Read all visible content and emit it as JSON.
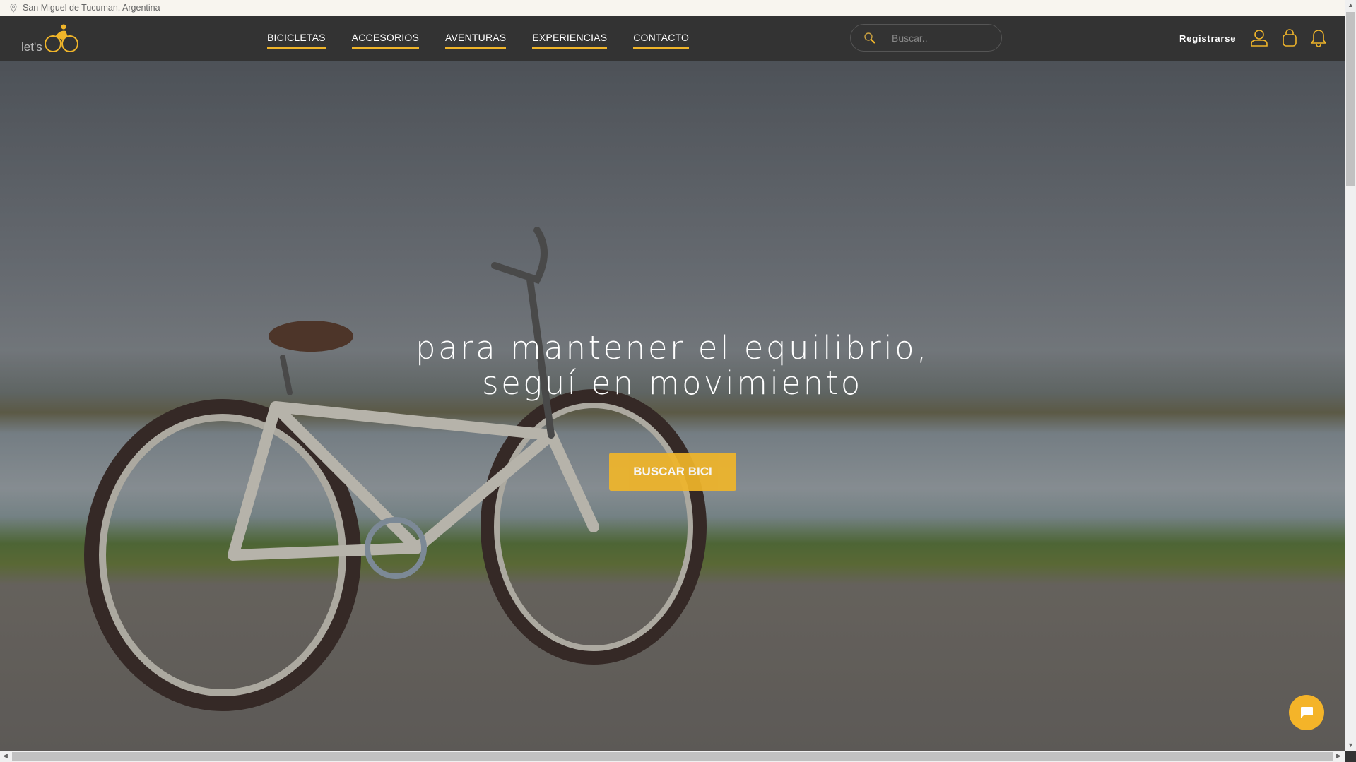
{
  "topbar": {
    "location": "San Miguel de Tucuman, Argentina"
  },
  "nav": {
    "logo_text": "let's GO",
    "items": [
      "BICICLETAS",
      "ACCESORIOS",
      "AVENTURAS",
      "EXPERIENCIAS",
      "CONTACTO"
    ],
    "search_placeholder": "Buscar..",
    "register_label": "Registrarse"
  },
  "hero": {
    "line1": "para mantener el equilibrio,",
    "line2": "seguí en movimiento",
    "cta_label": "BUSCAR BICI"
  },
  "colors": {
    "accent": "#f0b52a",
    "nav_bg": "#333333"
  }
}
